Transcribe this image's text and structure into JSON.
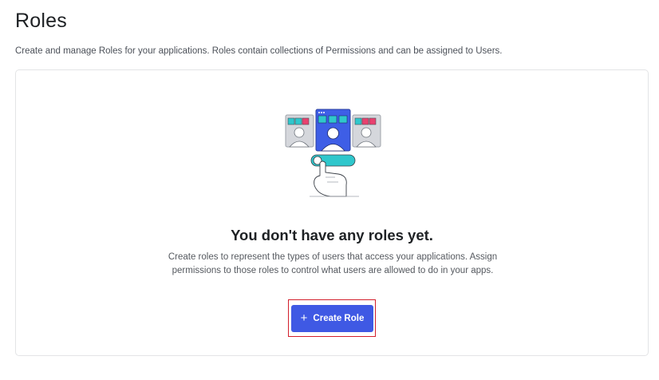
{
  "header": {
    "title": "Roles",
    "description": "Create and manage Roles for your applications. Roles contain collections of Permissions and can be assigned to Users."
  },
  "empty_state": {
    "illustration_icon": "roles-illustration-icon",
    "title": "You don't have any roles yet.",
    "description": "Create roles to represent the types of users that access your applications. Assign permissions to those roles to control what users are allowed to do in your apps.",
    "create_button": {
      "icon": "plus-icon",
      "icon_glyph": "+",
      "label": "Create Role"
    }
  },
  "colors": {
    "accent": "#3f59e4",
    "highlight_border": "#d31f2c",
    "illustration_blue": "#3e5ee6",
    "illustration_teal": "#2fc7cc",
    "illustration_pink": "#e8416f"
  }
}
